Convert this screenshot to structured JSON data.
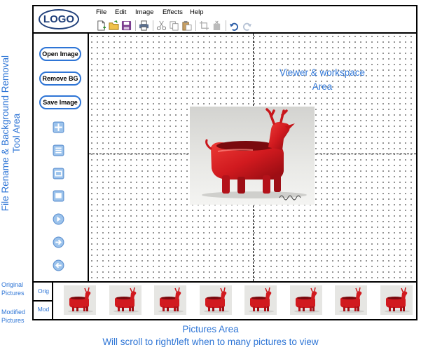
{
  "logo": {
    "text": "LOGO"
  },
  "menu": {
    "file": "File",
    "edit": "Edit",
    "image": "Image",
    "effects": "Effects",
    "help": "Help"
  },
  "toolbar": {
    "icons": [
      "new-file-icon",
      "open-folder-icon",
      "save-icon",
      "print-icon",
      "cut-icon",
      "copy-icon",
      "paste-icon",
      "crop-icon",
      "delete-icon",
      "undo-icon",
      "redo-icon"
    ]
  },
  "tools": {
    "open_image": "Open Image",
    "remove_bg": "Remove BG",
    "save_image": "Save Image",
    "icons": [
      "move-icon",
      "list-icon",
      "frame-icon",
      "window-icon",
      "play-icon",
      "forward-icon",
      "back-icon"
    ]
  },
  "workspace": {
    "label_line1": "Viewer  & workspace",
    "label_line2": "Area"
  },
  "side_label": {
    "line1": "File Rename & Background Removal",
    "line2": "Tool Area"
  },
  "pictures": {
    "tab_orig": "Orig",
    "tab_mod": "Mod",
    "label_original_line1": "Original",
    "label_original_line2": "Pictures",
    "label_modified_line1": "Modified",
    "label_modified_line2": "Pictures",
    "thumbnail_count": 8
  },
  "pictures_area": {
    "title": "Pictures Area",
    "subtitle": "Will scroll to right/left when to many pictures to view"
  },
  "colors": {
    "accent_blue": "#2e75d6",
    "logo_navy": "#1f3f7a",
    "deer_red": "#d11a1f"
  }
}
